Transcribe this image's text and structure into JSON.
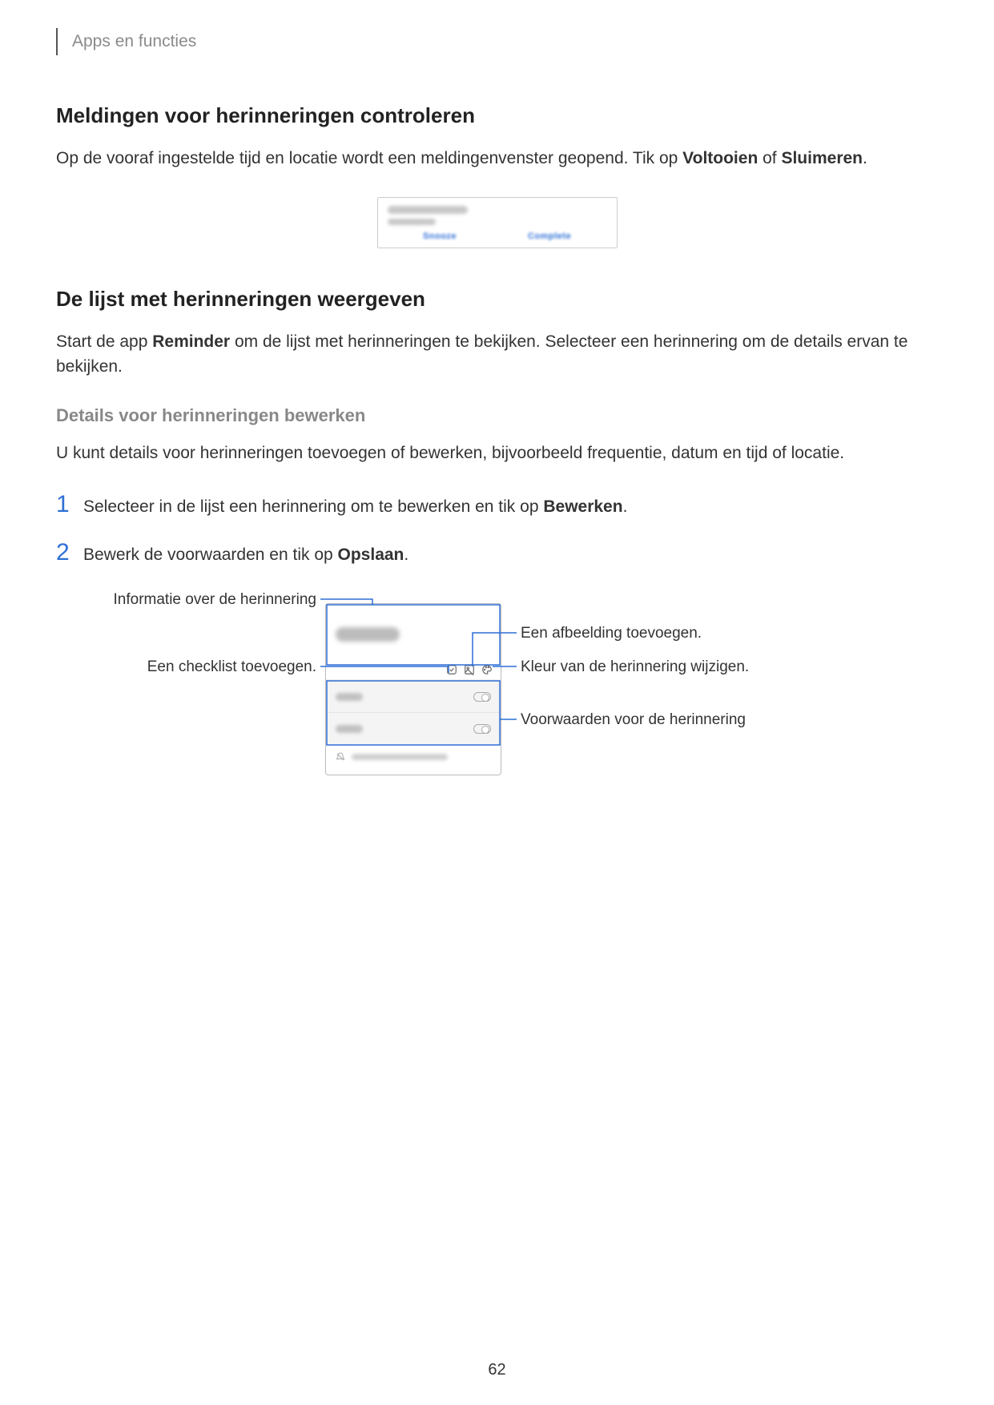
{
  "header": {
    "section": "Apps en functies"
  },
  "s1": {
    "title": "Meldingen voor herinneringen controleren",
    "p_before": "Op de vooraf ingestelde tijd en locatie wordt een meldingenvenster geopend. Tik op ",
    "bold1": "Voltooien",
    "mid": " of ",
    "bold2": "Sluimeren",
    "after": "."
  },
  "s2": {
    "title": "De lijst met herinneringen weergeven",
    "p_a": "Start de app ",
    "p_bold": "Reminder",
    "p_b": " om de lijst met herinneringen te bekijken. Selecteer een herinnering om de details ervan te bekijken."
  },
  "s3": {
    "title": "Details voor herinneringen bewerken",
    "p": "U kunt details voor herinneringen toevoegen of bewerken, bijvoorbeeld frequentie, datum en tijd of locatie."
  },
  "steps": {
    "n1": "1",
    "t1_a": "Selecteer in de lijst een herinnering om te bewerken en tik op ",
    "t1_bold": "Bewerken",
    "t1_b": ".",
    "n2": "2",
    "t2_a": "Bewerk de voorwaarden en tik op ",
    "t2_bold": "Opslaan",
    "t2_b": "."
  },
  "callouts": {
    "info": "Informatie over de herinnering",
    "checklist": "Een checklist toevoegen.",
    "add_image": "Een afbeelding toevoegen.",
    "change_color": "Kleur van de herinnering wijzigen.",
    "conditions": "Voorwaarden voor de herinnering"
  },
  "page_number": "62"
}
